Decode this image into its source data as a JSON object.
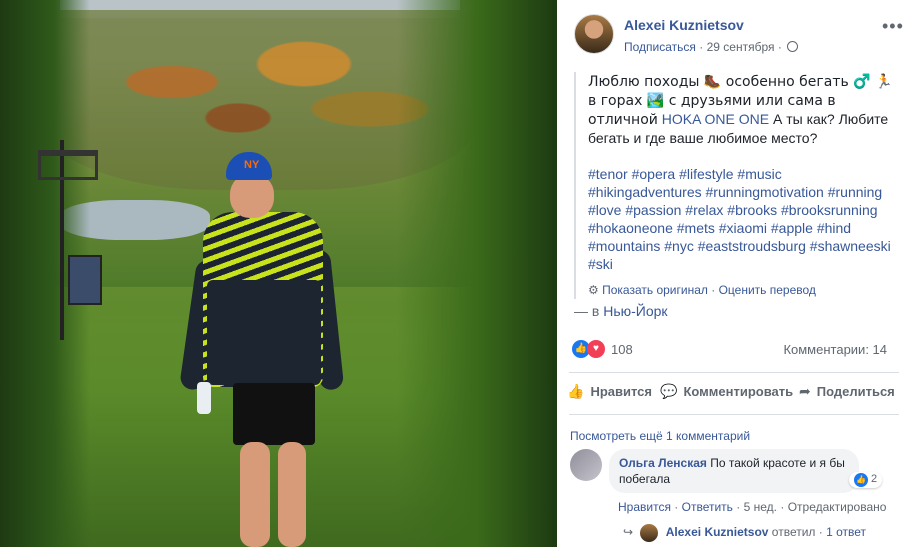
{
  "post": {
    "author": "Alexei Kuznietsov",
    "follow_label": "Подписаться",
    "date": "29 сентября",
    "more_label": "•••",
    "text_line1_before_link": "Люблю походы 🥾 особенно бегать ♂️ 🏃 в горах 🏞️ с друзьями или сама в отличной",
    "link_text": "HOKA ONE ONE",
    "text_after_link": "А ты как? Любите бегать и где ваше любимое место?",
    "hashtags": "#tenor #opera #lifestyle #music #hikingadventures #runningmotivation #running #love #passion #relax #brooks #brooksrunning #hokaoneone #mets #xiaomi #apple #hind #mountains #nyc #eaststroudsburg #shawneeski #ski",
    "show_original": "Показать оригинал",
    "rate_translation": "Оценить перевод",
    "location_prefix": "— в",
    "location": "Нью-Йорк"
  },
  "stats": {
    "reactions": "108",
    "comments": "Комментарии: 14"
  },
  "actions": {
    "like": "Нравится",
    "comment": "Комментировать",
    "share": "Поделиться"
  },
  "comments": {
    "view_more": "Посмотреть ещё 1 комментарий",
    "items": [
      {
        "name": "Ольга Ленская",
        "text": "По такой красоте и я бы побегала",
        "reactions": "2",
        "like_label": "Нравится",
        "reply_label": "Ответить",
        "time": "5 нед.",
        "edited": "Отредактировано"
      }
    ],
    "reply_author": "Alexei Kuznietsov",
    "reply_verb": "ответил",
    "reply_count": "1 ответ"
  },
  "photo": {
    "cap_logo": "NY"
  },
  "colors": {
    "link": "#385898",
    "muted": "#606770",
    "like_blue": "#1877f2",
    "love_red": "#f33e58"
  },
  "icons": {
    "globe": "globe-icon",
    "gear": "gear-icon",
    "like": "thumbs-up-icon",
    "comment": "comment-icon",
    "share": "share-icon"
  }
}
